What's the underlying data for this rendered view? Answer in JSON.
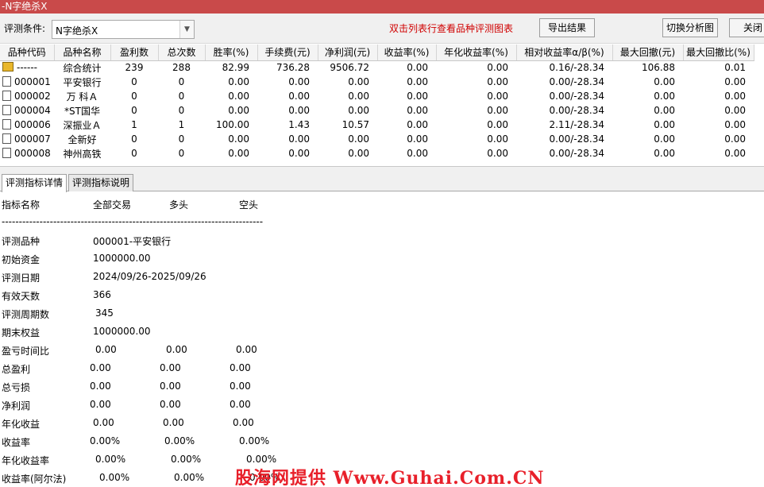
{
  "window": {
    "title": "-N字绝杀X"
  },
  "toolbar": {
    "condition_label": "评测条件:",
    "condition_value": "N字绝杀X",
    "hint": "双击列表行查看品种评测图表",
    "export_label": "导出结果",
    "switch_label": "切换分析图",
    "close_label": "关闭"
  },
  "grid": {
    "columns": [
      "品种代码",
      "品种名称",
      "盈利数",
      "总次数",
      "胜率(%)",
      "手续费(元)",
      "净利润(元)",
      "收益率(%)",
      "年化收益率(%)",
      "相对收益率α/β(%)",
      "最大回撤(元)",
      "最大回撤比(%)"
    ],
    "rows": [
      [
        "------",
        "综合统计",
        "239",
        "288",
        "82.99",
        "736.28",
        "9506.72",
        "0.00",
        "0.00",
        "0.16/-28.34",
        "106.88",
        "0.01"
      ],
      [
        "000001",
        "平安银行",
        "0",
        "0",
        "0.00",
        "0.00",
        "0.00",
        "0.00",
        "0.00",
        "0.00/-28.34",
        "0.00",
        "0.00"
      ],
      [
        "000002",
        "万 科Ａ",
        "0",
        "0",
        "0.00",
        "0.00",
        "0.00",
        "0.00",
        "0.00",
        "0.00/-28.34",
        "0.00",
        "0.00"
      ],
      [
        "000004",
        "*ST国华",
        "0",
        "0",
        "0.00",
        "0.00",
        "0.00",
        "0.00",
        "0.00",
        "0.00/-28.34",
        "0.00",
        "0.00"
      ],
      [
        "000006",
        "深振业Ａ",
        "1",
        "1",
        "100.00",
        "1.43",
        "10.57",
        "0.00",
        "0.00",
        "2.11/-28.34",
        "0.00",
        "0.00"
      ],
      [
        "000007",
        "全新好",
        "0",
        "0",
        "0.00",
        "0.00",
        "0.00",
        "0.00",
        "0.00",
        "0.00/-28.34",
        "0.00",
        "0.00"
      ],
      [
        "000008",
        "神州高铁",
        "0",
        "0",
        "0.00",
        "0.00",
        "0.00",
        "0.00",
        "0.00",
        "0.00/-28.34",
        "0.00",
        "0.00"
      ]
    ]
  },
  "tabs": [
    "评测指标详情",
    "评测指标说明"
  ],
  "detail": {
    "headers": {
      "name": "指标名称",
      "all": "全部交易",
      "long": "多头",
      "short": "空头"
    },
    "separator": "----------------------------------------------------------------------------",
    "info": [
      {
        "label": "评测品种",
        "value": "000001-平安银行"
      },
      {
        "label": "初始资金",
        "value": "1000000.00"
      },
      {
        "label": "评测日期",
        "value": "2024/09/26-2025/09/26"
      },
      {
        "label": "有效天数",
        "value": "366"
      },
      {
        "label": "评测周期数",
        "value": "345"
      },
      {
        "label": "期末权益",
        "value": "1000000.00"
      }
    ],
    "metrics": [
      {
        "label": "盈亏时间比",
        "all": "0.00",
        "long": "0.00",
        "short": "0.00"
      },
      {
        "label": "总盈利",
        "all": "0.00",
        "long": "0.00",
        "short": "0.00"
      },
      {
        "label": "总亏损",
        "all": "0.00",
        "long": "0.00",
        "short": "0.00"
      },
      {
        "label": "净利润",
        "all": "0.00",
        "long": "0.00",
        "short": "0.00"
      },
      {
        "label": "年化收益",
        "all": "0.00",
        "long": "0.00",
        "short": "0.00"
      },
      {
        "label": "收益率",
        "all": "0.00%",
        "long": "0.00%",
        "short": "0.00%"
      },
      {
        "label": "年化收益率",
        "all": "0.00%",
        "long": "0.00%",
        "short": "0.00%"
      },
      {
        "label": "收益率(阿尔法)",
        "all": "0.00%",
        "long": "0.00%",
        "short": "0.00%"
      }
    ]
  },
  "watermark": "股海网提供 Www.Guhai.Com.CN"
}
